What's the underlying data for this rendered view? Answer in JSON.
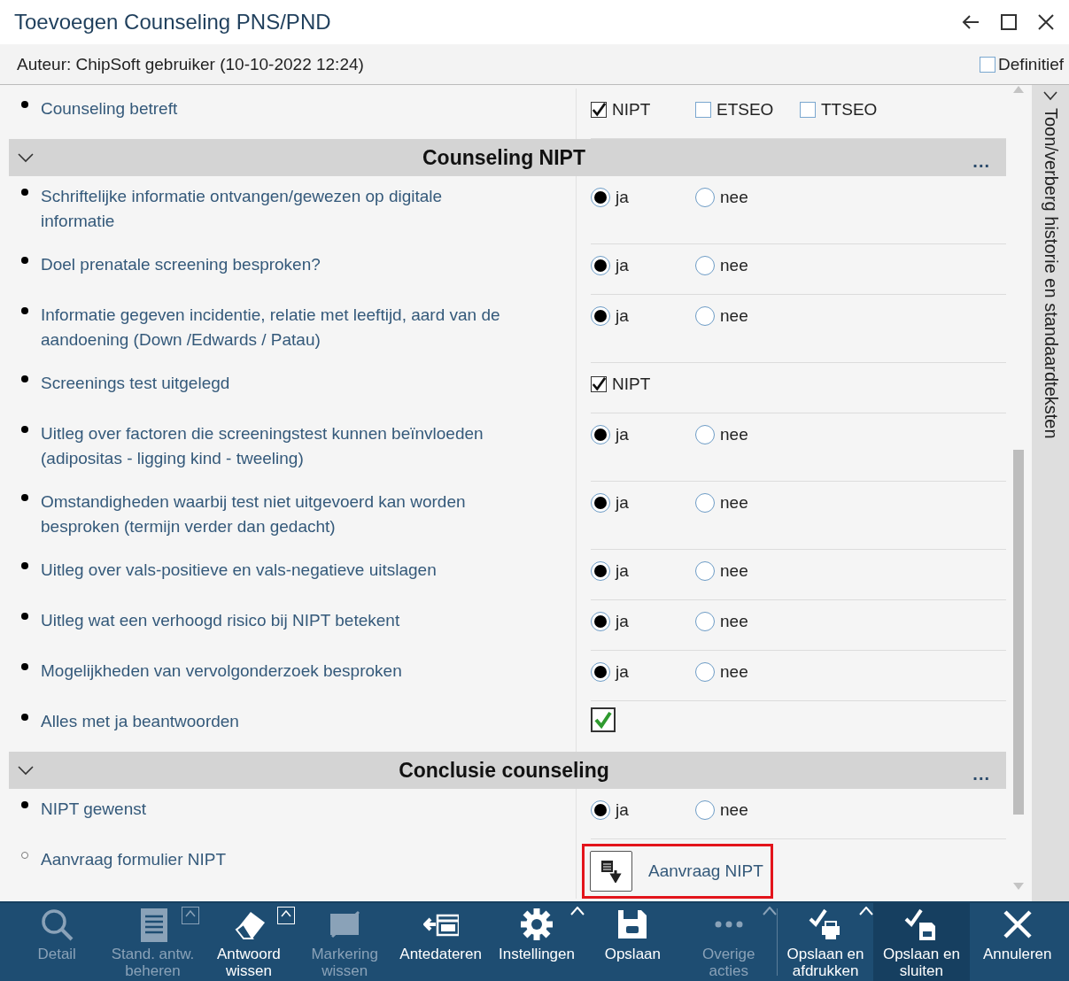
{
  "window": {
    "title": "Toevoegen Counseling PNS/PND"
  },
  "header": {
    "author": "Auteur: ChipSoft gebruiker (10-10-2022 12:24)",
    "final": {
      "label": "Definitief",
      "checked": false
    }
  },
  "form": [
    {
      "kind": "question",
      "required": true,
      "label": "Counseling betreft",
      "answer": {
        "kind": "checks",
        "options": [
          {
            "label": "NIPT",
            "checked": true
          },
          {
            "label": "ETSEO",
            "checked": false
          },
          {
            "label": "TTSEO",
            "checked": false
          }
        ]
      }
    },
    {
      "kind": "section",
      "title": "Counseling NIPT",
      "expanded": true,
      "more": "..."
    },
    {
      "kind": "question",
      "required": true,
      "label": "Schriftelijke informatie ontvangen/gewezen op digitale informatie",
      "answer": {
        "kind": "radio",
        "options": [
          {
            "label": "ja",
            "selected": true
          },
          {
            "label": "nee",
            "selected": false
          }
        ]
      }
    },
    {
      "kind": "question",
      "required": true,
      "label": "Doel prenatale screening besproken?",
      "answer": {
        "kind": "radio",
        "options": [
          {
            "label": "ja",
            "selected": true
          },
          {
            "label": "nee",
            "selected": false
          }
        ]
      }
    },
    {
      "kind": "question",
      "required": true,
      "label": "Informatie gegeven incidentie, relatie met leeftijd, aard van de aandoening (Down /Edwards / Patau)",
      "answer": {
        "kind": "radio",
        "options": [
          {
            "label": "ja",
            "selected": true
          },
          {
            "label": "nee",
            "selected": false
          }
        ]
      }
    },
    {
      "kind": "question",
      "required": true,
      "label": "Screenings test uitgelegd",
      "answer": {
        "kind": "checks",
        "options": [
          {
            "label": "NIPT",
            "checked": true
          }
        ]
      }
    },
    {
      "kind": "question",
      "required": true,
      "label": "Uitleg over factoren die screeningstest kunnen beïnvloeden (adipositas - ligging kind - tweeling)",
      "answer": {
        "kind": "radio",
        "options": [
          {
            "label": "ja",
            "selected": true
          },
          {
            "label": "nee",
            "selected": false
          }
        ]
      }
    },
    {
      "kind": "question",
      "required": true,
      "label": "Omstandigheden waarbij test niet uitgevoerd kan worden besproken (termijn verder dan gedacht)",
      "answer": {
        "kind": "radio",
        "options": [
          {
            "label": "ja",
            "selected": true
          },
          {
            "label": "nee",
            "selected": false
          }
        ]
      }
    },
    {
      "kind": "question",
      "required": true,
      "label": "Uitleg over vals-positieve en vals-negatieve uitslagen",
      "answer": {
        "kind": "radio",
        "options": [
          {
            "label": "ja",
            "selected": true
          },
          {
            "label": "nee",
            "selected": false
          }
        ]
      }
    },
    {
      "kind": "question",
      "required": true,
      "label": "Uitleg wat een verhoogd risico bij NIPT betekent",
      "answer": {
        "kind": "radio",
        "options": [
          {
            "label": "ja",
            "selected": true
          },
          {
            "label": "nee",
            "selected": false
          }
        ]
      }
    },
    {
      "kind": "question",
      "required": true,
      "label": "Mogelijkheden van vervolgonderzoek besproken",
      "answer": {
        "kind": "radio",
        "options": [
          {
            "label": "ja",
            "selected": true
          },
          {
            "label": "nee",
            "selected": false
          }
        ]
      }
    },
    {
      "kind": "question",
      "required": true,
      "label": "Alles met ja beantwoorden",
      "answer": {
        "kind": "toggle",
        "checked": true
      }
    },
    {
      "kind": "section",
      "title": "Conclusie counseling",
      "expanded": true,
      "more": "..."
    },
    {
      "kind": "question",
      "required": true,
      "label": "NIPT gewenst",
      "answer": {
        "kind": "radio",
        "options": [
          {
            "label": "ja",
            "selected": true
          },
          {
            "label": "nee",
            "selected": false
          }
        ]
      }
    },
    {
      "kind": "question",
      "required": false,
      "label": "Aanvraag formulier NIPT",
      "answer": {
        "kind": "button",
        "label": "Aanvraag NIPT"
      }
    }
  ],
  "side_panel": {
    "label": "Toon/verberg historie en standaardteksten",
    "expanded": false
  },
  "toolbar": [
    {
      "kind": "plain",
      "label": "Detail",
      "disabled": true,
      "highlighted": false
    },
    {
      "kind": "boxmenu",
      "label": "Stand. antw.\nbeheren",
      "disabled": true,
      "highlighted": false
    },
    {
      "kind": "boxmenu",
      "label": "Antwoord\nwissen",
      "disabled": false,
      "highlighted": false
    },
    {
      "kind": "plain",
      "label": "Markering\nwissen",
      "disabled": true,
      "highlighted": false
    },
    {
      "kind": "plain",
      "label": "Antedateren",
      "disabled": false,
      "highlighted": false
    },
    {
      "kind": "menu",
      "label": "Instellingen",
      "disabled": false,
      "highlighted": false
    },
    {
      "kind": "plain",
      "label": "Opslaan",
      "disabled": false,
      "highlighted": false
    },
    {
      "kind": "menu",
      "label": "Overige\nacties",
      "disabled": true,
      "highlighted": false
    },
    {
      "kind": "menu",
      "label": "Opslaan en\nafdrukken",
      "disabled": false,
      "highlighted": false
    },
    {
      "kind": "plain",
      "label": "Opslaan en\nsluiten",
      "disabled": false,
      "highlighted": true
    },
    {
      "kind": "plain",
      "label": "Annuleren",
      "disabled": false,
      "highlighted": false
    }
  ]
}
